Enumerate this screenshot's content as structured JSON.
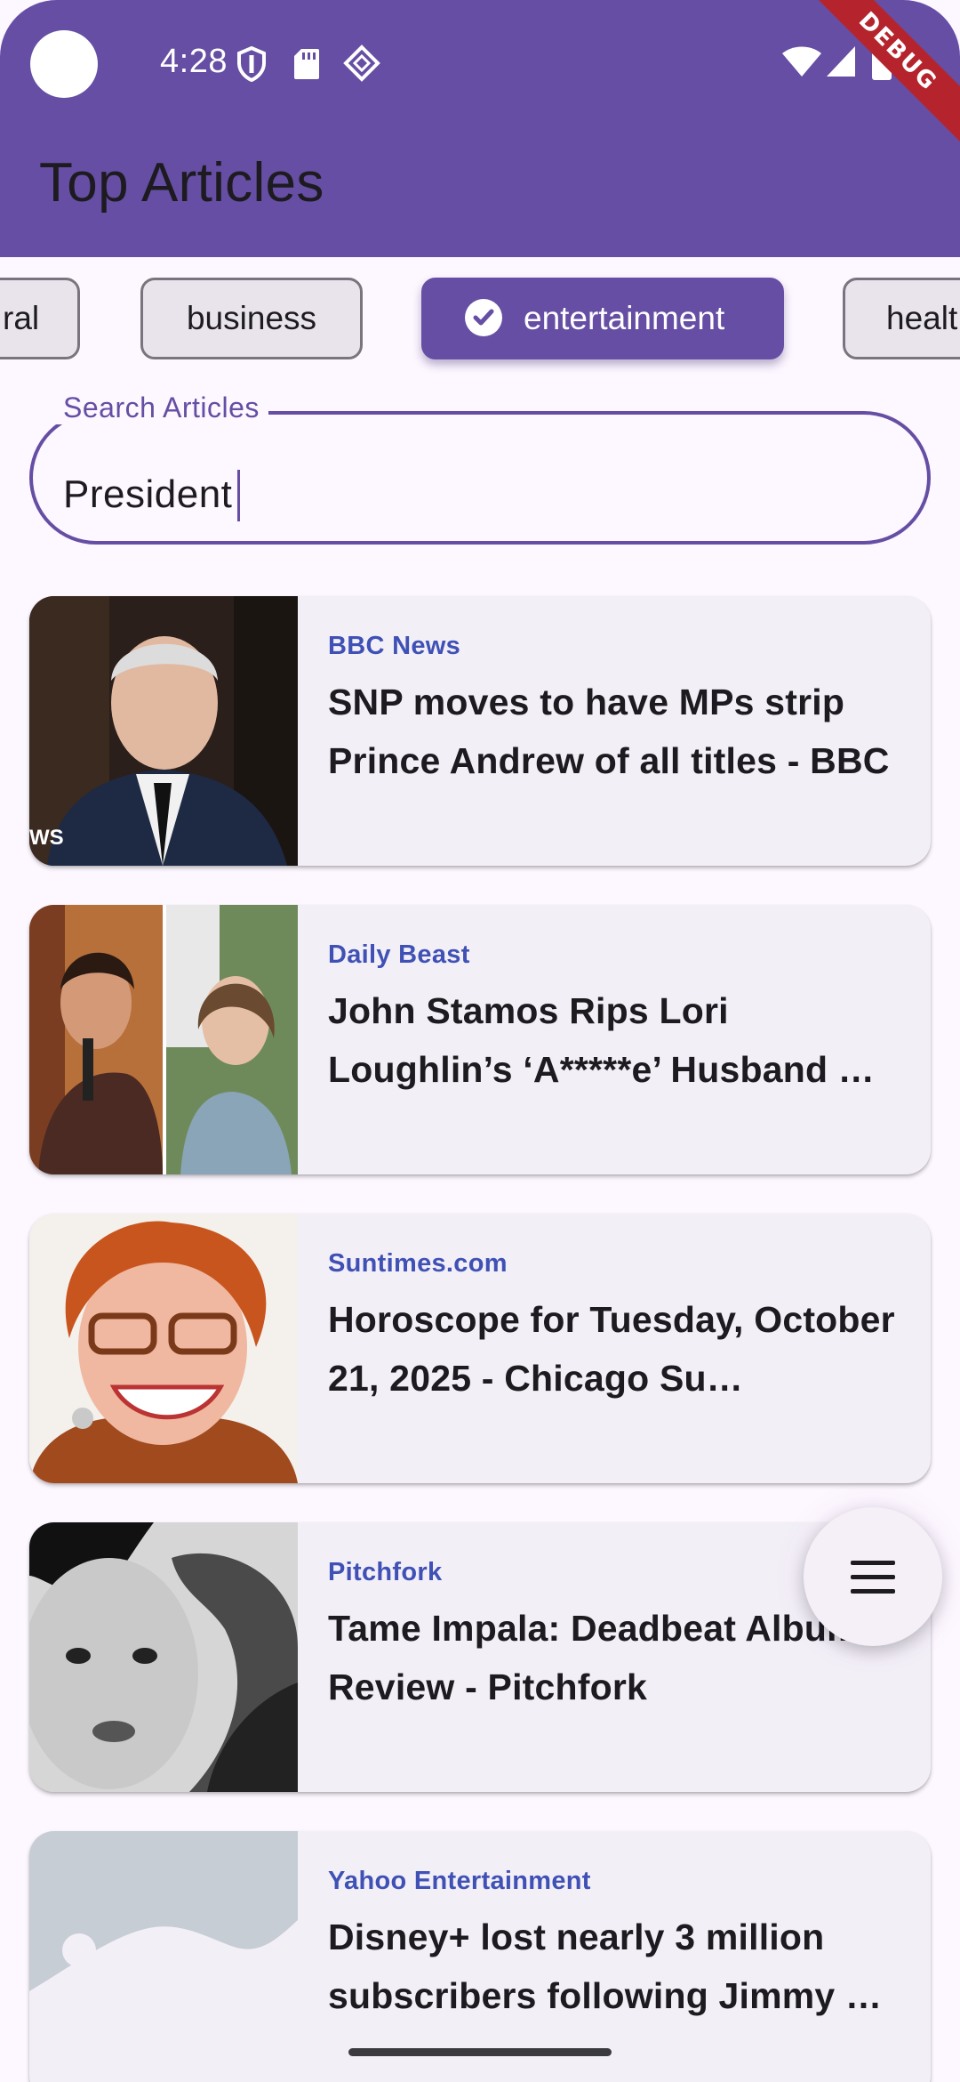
{
  "status_bar": {
    "time": "4:28",
    "icons": [
      "shield-icon",
      "sd-card-icon",
      "diamond-icon",
      "wifi-icon",
      "signal-icon",
      "battery-icon"
    ],
    "debug_banner": "DEBUG"
  },
  "app_bar": {
    "title": "Top Articles",
    "color": "#654ea3"
  },
  "categories": {
    "items": [
      "general",
      "business",
      "entertainment",
      "health"
    ],
    "visible_labels": [
      "ral",
      "business",
      "entertainment",
      "healt"
    ],
    "selected": "entertainment"
  },
  "search": {
    "label": "Search Articles",
    "value": "President"
  },
  "articles": [
    {
      "source": "BBC News",
      "title": "SNP moves to have MPs strip Prince Andrew of all titles - BBC",
      "thumb_overlay": "WS"
    },
    {
      "source": "Daily Beast",
      "title": "John Stamos Rips Lori Loughlin’s ‘A*****e’ Husband …"
    },
    {
      "source": "Suntimes.com",
      "title": "Horoscope for Tuesday, October 21, 2025 - Chicago Su…"
    },
    {
      "source": "Pitchfork",
      "title": "Tame Impala: Deadbeat Album Review - Pitchfork"
    },
    {
      "source": "Yahoo Entertainment",
      "title": "Disney+ lost nearly 3 million subscribers following Jimmy …"
    }
  ],
  "fab": {
    "icon": "menu-icon"
  },
  "colors": {
    "accent": "#654ea3",
    "source_text": "#3f51b5",
    "background": "#fdf7ff"
  }
}
